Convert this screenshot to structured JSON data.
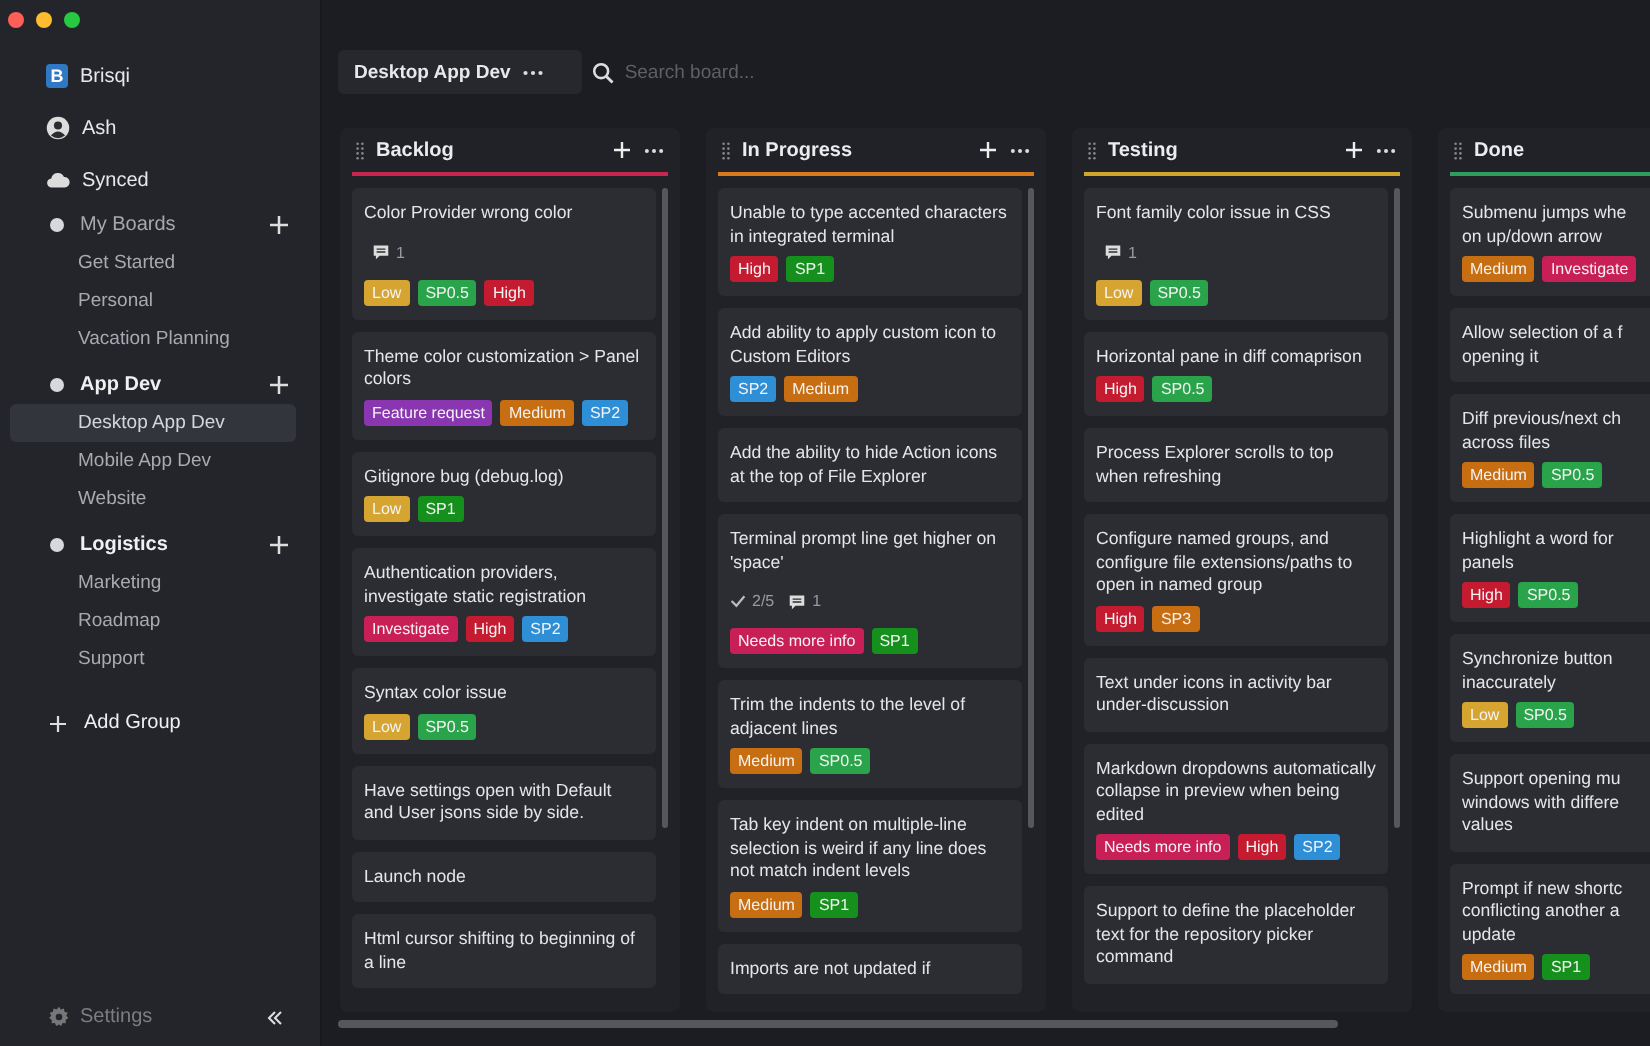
{
  "sidebar": {
    "logo_letter": "B",
    "app_name": "Brisqi",
    "user": "Ash",
    "sync_status": "Synced",
    "groups": [
      {
        "name": "My Boards",
        "highlighted": false,
        "boards": [
          {
            "name": "Get Started",
            "selected": false
          },
          {
            "name": "Personal",
            "selected": false
          },
          {
            "name": "Vacation Planning",
            "selected": false
          }
        ]
      },
      {
        "name": "App Dev",
        "highlighted": true,
        "boards": [
          {
            "name": "Desktop App Dev",
            "selected": true
          },
          {
            "name": "Mobile App Dev",
            "selected": false
          },
          {
            "name": "Website",
            "selected": false
          }
        ]
      },
      {
        "name": "Logistics",
        "highlighted": true,
        "boards": [
          {
            "name": "Marketing",
            "selected": false
          },
          {
            "name": "Roadmap",
            "selected": false
          },
          {
            "name": "Support",
            "selected": false
          }
        ]
      }
    ],
    "add_group": "Add Group",
    "settings": "Settings"
  },
  "toolbar": {
    "board_title": "Desktop App Dev",
    "search": {
      "placeholder": "Search board..."
    }
  },
  "columns": [
    {
      "title": "Backlog",
      "color": "#c8254f",
      "cards": [
        {
          "title": "Color Provider wrong color",
          "comments": "1",
          "tags": [
            {
              "label": "Low",
              "color": "#d6a531"
            },
            {
              "label": "SP0.5",
              "color": "#2aa44a"
            },
            {
              "label": "High",
              "color": "#c41b30"
            }
          ]
        },
        {
          "title": "Theme color customization > Panel colors",
          "tags": [
            {
              "label": "Feature request",
              "color": "#8a36b0"
            },
            {
              "label": "Medium",
              "color": "#c86e12"
            },
            {
              "label": "SP2",
              "color": "#2f8fd6"
            }
          ]
        },
        {
          "title": "Gitignore bug (debug.log)",
          "tags": [
            {
              "label": "Low",
              "color": "#d6a531"
            },
            {
              "label": "SP1",
              "color": "#16901c"
            }
          ]
        },
        {
          "title": "Authentication providers, investigate static registration",
          "tags": [
            {
              "label": "Investigate",
              "color": "#c81f56"
            },
            {
              "label": "High",
              "color": "#c41b30"
            },
            {
              "label": "SP2",
              "color": "#2f8fd6"
            }
          ]
        },
        {
          "title": "Syntax color issue",
          "tags": [
            {
              "label": "Low",
              "color": "#d6a531"
            },
            {
              "label": "SP0.5",
              "color": "#2aa44a"
            }
          ]
        },
        {
          "title": "Have settings open with Default and User jsons side by side."
        },
        {
          "title": "Launch node"
        },
        {
          "title": "Html cursor shifting to beginning of a line"
        }
      ]
    },
    {
      "title": "In Progress",
      "color": "#d67a1c",
      "cards": [
        {
          "title": "Unable to type accented characters in integrated terminal",
          "tags": [
            {
              "label": "High",
              "color": "#c41b30"
            },
            {
              "label": "SP1",
              "color": "#16901c"
            }
          ]
        },
        {
          "title": "Add ability to apply custom icon to Custom Editors",
          "tags": [
            {
              "label": "SP2",
              "color": "#2f8fd6"
            },
            {
              "label": "Medium",
              "color": "#c86e12"
            }
          ]
        },
        {
          "title": "Add the ability to hide Action icons at the top of File Explorer"
        },
        {
          "title": "Terminal prompt line get higher on 'space'",
          "checklist": "2/5",
          "comments": "1",
          "tags": [
            {
              "label": "Needs more info",
              "color": "#c81f56"
            },
            {
              "label": "SP1",
              "color": "#16901c"
            }
          ]
        },
        {
          "title": "Trim the indents to the level of adjacent lines",
          "tags": [
            {
              "label": "Medium",
              "color": "#c86e12"
            },
            {
              "label": "SP0.5",
              "color": "#2aa44a"
            }
          ]
        },
        {
          "title": "Tab key indent on multiple-line selection is weird if any line does not match indent levels",
          "tags": [
            {
              "label": "Medium",
              "color": "#c86e12"
            },
            {
              "label": "SP1",
              "color": "#16901c"
            }
          ]
        },
        {
          "title": "Imports are not updated if"
        }
      ]
    },
    {
      "title": "Testing",
      "color": "#cfa62c",
      "cards": [
        {
          "title": "Font family color issue in CSS",
          "comments": "1",
          "tags": [
            {
              "label": "Low",
              "color": "#d6a531"
            },
            {
              "label": "SP0.5",
              "color": "#2aa44a"
            }
          ]
        },
        {
          "title": "Horizontal pane in diff comaprison",
          "tags": [
            {
              "label": "High",
              "color": "#c41b30"
            },
            {
              "label": "SP0.5",
              "color": "#2aa44a"
            }
          ]
        },
        {
          "title": "Process Explorer scrolls to top when refreshing"
        },
        {
          "title": "Configure named groups, and configure file extensions/paths to open in named group",
          "tags": [
            {
              "label": "High",
              "color": "#c41b30"
            },
            {
              "label": "SP3",
              "color": "#c86e12"
            }
          ]
        },
        {
          "title": "Text under icons in activity bar under-discussion"
        },
        {
          "title": "Markdown dropdowns automatically collapse in preview when being edited",
          "tags": [
            {
              "label": "Needs more info",
              "color": "#c81f56"
            },
            {
              "label": "High",
              "color": "#c41b30"
            },
            {
              "label": "SP2",
              "color": "#2f8fd6"
            }
          ]
        },
        {
          "title": "Support to define the placeholder text for the repository picker command"
        }
      ]
    },
    {
      "title": "Done",
      "color": "#2f9e5c",
      "cards": [
        {
          "title": "Submenu jumps whe\non up/down arrow",
          "tags": [
            {
              "label": "Medium",
              "color": "#c86e12"
            },
            {
              "label": "Investigate",
              "color": "#c81f56"
            }
          ]
        },
        {
          "title": "Allow selection of a f\nopening it"
        },
        {
          "title": "Diff previous/next ch\nacross files",
          "tags": [
            {
              "label": "Medium",
              "color": "#c86e12"
            },
            {
              "label": "SP0.5",
              "color": "#2aa44a"
            }
          ]
        },
        {
          "title": "Highlight a word for\npanels",
          "tags": [
            {
              "label": "High",
              "color": "#c41b30"
            },
            {
              "label": "SP0.5",
              "color": "#2aa44a"
            }
          ]
        },
        {
          "title": "Synchronize button\ninaccurately",
          "tags": [
            {
              "label": "Low",
              "color": "#d6a531"
            },
            {
              "label": "SP0.5",
              "color": "#2aa44a"
            }
          ]
        },
        {
          "title": "Support opening mu\nwindows with differe\nvalues"
        },
        {
          "title": "Prompt if new shortc\nconflicting another a\nupdate",
          "tags": [
            {
              "label": "Medium",
              "color": "#c86e12"
            },
            {
              "label": "SP1",
              "color": "#16901c"
            }
          ]
        }
      ]
    }
  ]
}
